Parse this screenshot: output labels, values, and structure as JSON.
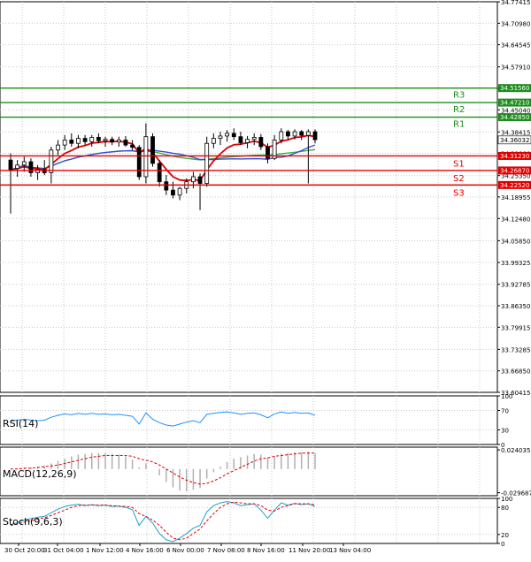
{
  "chart_data": [
    {
      "type": "candlestick",
      "panel": "price",
      "yticks": [
        34.77415,
        34.7098,
        34.64545,
        34.5791,
        34.51475,
        34.4504,
        34.38415,
        34.3198,
        34.2535,
        34.18955,
        34.1248,
        34.0585,
        33.99325,
        33.92785,
        33.8635,
        33.79915,
        33.73285,
        33.6685,
        33.60415
      ],
      "ytick_labels": [
        "34.77415",
        "34.70980",
        "34.64545",
        "34.57910",
        "34.51475",
        "34.45040",
        "34.38415",
        "34.31980",
        "34.25350",
        "34.18955",
        "34.12480",
        "34.05850",
        "33.99325",
        "33.92785",
        "33.86350",
        "33.79915",
        "33.73285",
        "33.66850",
        "33.60415"
      ],
      "ylim": [
        33.60415,
        34.77415
      ],
      "current_price": 34.36032,
      "current_price_label": "34.36032",
      "levels": [
        {
          "name": "R3",
          "value": 34.5156,
          "label": "34.51560",
          "color": "#1e8c1e"
        },
        {
          "name": "R2",
          "value": 34.4721,
          "label": "34.47210",
          "color": "#1e8c1e"
        },
        {
          "name": "R1",
          "value": 34.4285,
          "label": "34.42850",
          "color": "#1e8c1e"
        },
        {
          "name": "S1",
          "value": 34.3123,
          "label": "34.31230",
          "color": "#e00000"
        },
        {
          "name": "S2",
          "value": 34.2687,
          "label": "34.26870",
          "color": "#e00000"
        },
        {
          "name": "S3",
          "value": 34.2252,
          "label": "34.22520",
          "color": "#e00000"
        }
      ],
      "x_labels": [
        "30 Oct 20:00",
        "31 Oct 04:00",
        "1 Nov 12:00",
        "4 Nov 16:00",
        "6 Nov 00:00",
        "7 Nov 08:00",
        "8 Nov 16:00",
        "11 Nov 20:00",
        "13 Nov 04:00"
      ],
      "candles": [
        [
          34.3,
          34.32,
          34.14,
          34.27
        ],
        [
          34.275,
          34.3,
          34.25,
          34.285
        ],
        [
          34.285,
          34.31,
          34.265,
          34.295
        ],
        [
          34.295,
          34.305,
          34.25,
          34.262
        ],
        [
          34.262,
          34.285,
          34.24,
          34.272
        ],
        [
          34.272,
          34.3,
          34.255,
          34.262
        ],
        [
          34.262,
          34.34,
          34.23,
          34.33
        ],
        [
          34.33,
          34.36,
          34.315,
          34.345
        ],
        [
          34.345,
          34.375,
          34.33,
          34.36
        ],
        [
          34.36,
          34.38,
          34.34,
          34.35
        ],
        [
          34.35,
          34.375,
          34.335,
          34.365
        ],
        [
          34.365,
          34.375,
          34.345,
          34.355
        ],
        [
          34.355,
          34.375,
          34.34,
          34.368
        ],
        [
          34.368,
          34.38,
          34.35,
          34.358
        ],
        [
          34.358,
          34.37,
          34.34,
          34.362
        ],
        [
          34.362,
          34.37,
          34.345,
          34.354
        ],
        [
          34.354,
          34.37,
          34.34,
          34.36
        ],
        [
          34.36,
          34.372,
          34.34,
          34.345
        ],
        [
          34.345,
          34.36,
          34.33,
          34.338
        ],
        [
          34.338,
          34.345,
          34.24,
          34.25
        ],
        [
          34.25,
          34.41,
          34.23,
          34.37
        ],
        [
          34.37,
          34.38,
          34.28,
          34.29
        ],
        [
          34.29,
          34.3,
          34.22,
          34.235
        ],
        [
          34.235,
          34.255,
          34.195,
          34.21
        ],
        [
          34.21,
          34.235,
          34.185,
          34.195
        ],
        [
          34.195,
          34.22,
          34.18,
          34.215
        ],
        [
          34.215,
          34.245,
          34.2,
          34.235
        ],
        [
          34.235,
          34.265,
          34.215,
          34.25
        ],
        [
          34.25,
          34.26,
          34.15,
          34.23
        ],
        [
          34.23,
          34.37,
          34.22,
          34.35
        ],
        [
          34.35,
          34.38,
          34.335,
          34.365
        ],
        [
          34.365,
          34.385,
          34.345,
          34.372
        ],
        [
          34.372,
          34.39,
          34.355,
          34.38
        ],
        [
          34.38,
          34.395,
          34.36,
          34.37
        ],
        [
          34.37,
          34.385,
          34.345,
          34.352
        ],
        [
          34.352,
          34.372,
          34.335,
          34.362
        ],
        [
          34.362,
          34.38,
          34.345,
          34.368
        ],
        [
          34.368,
          34.378,
          34.33,
          34.34
        ],
        [
          34.34,
          34.35,
          34.29,
          34.305
        ],
        [
          34.305,
          34.375,
          34.3,
          34.36
        ],
        [
          34.36,
          34.395,
          34.35,
          34.385
        ],
        [
          34.385,
          34.39,
          34.36,
          34.372
        ],
        [
          34.372,
          34.392,
          34.362,
          34.385
        ],
        [
          34.385,
          34.39,
          34.36,
          34.374
        ],
        [
          34.374,
          34.392,
          34.23,
          34.385
        ],
        [
          34.385,
          34.392,
          34.35,
          34.361
        ]
      ]
    },
    {
      "type": "line",
      "panel": "rsi",
      "title": "RSI(14)",
      "yticks": [
        100,
        70,
        30,
        0
      ],
      "ytick_labels": [
        "100",
        "70",
        "30",
        "0"
      ],
      "ylim": [
        0,
        100
      ],
      "values": [
        48,
        50,
        52,
        50,
        49,
        50,
        56,
        60,
        63,
        61,
        64,
        62,
        64,
        62,
        63,
        61,
        62,
        60,
        58,
        42,
        65,
        52,
        45,
        40,
        38,
        42,
        46,
        49,
        45,
        62,
        64,
        66,
        67,
        65,
        62,
        64,
        65,
        61,
        55,
        63,
        67,
        64,
        66,
        64,
        65,
        60
      ]
    },
    {
      "type": "bar",
      "panel": "macd",
      "title": "MACD(12,26,9)",
      "yticks": [
        0.024035,
        -0.029687
      ],
      "ytick_labels": [
        "0.024035",
        "-0.029687"
      ],
      "ylim": [
        -0.0335,
        0.0275
      ],
      "histogram": [
        0.0,
        0.001,
        0.002,
        0.002,
        0.003,
        0.004,
        0.007,
        0.01,
        0.013,
        0.016,
        0.018,
        0.019,
        0.02,
        0.02,
        0.02,
        0.019,
        0.018,
        0.016,
        0.012,
        0.002,
        0.007,
        0.0,
        -0.008,
        -0.016,
        -0.023,
        -0.027,
        -0.028,
        -0.026,
        -0.024,
        -0.012,
        -0.004,
        0.003,
        0.009,
        0.013,
        0.015,
        0.017,
        0.019,
        0.018,
        0.014,
        0.016,
        0.019,
        0.02,
        0.021,
        0.021,
        0.022,
        0.02
      ],
      "signal": [
        0.0,
        0.0,
        0.001,
        0.001,
        0.002,
        0.003,
        0.004,
        0.005,
        0.007,
        0.009,
        0.011,
        0.013,
        0.015,
        0.016,
        0.017,
        0.017,
        0.017,
        0.017,
        0.016,
        0.013,
        0.011,
        0.009,
        0.005,
        0.0,
        -0.005,
        -0.01,
        -0.014,
        -0.017,
        -0.019,
        -0.018,
        -0.015,
        -0.011,
        -0.006,
        -0.002,
        0.002,
        0.006,
        0.01,
        0.013,
        0.014,
        0.016,
        0.017,
        0.018,
        0.019,
        0.02,
        0.02,
        0.02
      ]
    },
    {
      "type": "line",
      "panel": "stoch",
      "title": "Stoch(9,6,3)",
      "yticks": [
        100,
        80,
        20,
        0
      ],
      "ytick_labels": [
        "100",
        "80",
        "20",
        "0"
      ],
      "ylim": [
        0,
        100
      ],
      "main": [
        42,
        46,
        52,
        55,
        58,
        60,
        68,
        76,
        82,
        85,
        87,
        84,
        86,
        84,
        85,
        82,
        83,
        80,
        75,
        40,
        60,
        45,
        22,
        8,
        4,
        12,
        22,
        34,
        40,
        70,
        84,
        90,
        93,
        90,
        84,
        86,
        88,
        74,
        56,
        74,
        90,
        85,
        89,
        86,
        88,
        82
      ],
      "signal": [
        40,
        43,
        47,
        50,
        54,
        57,
        62,
        68,
        74,
        80,
        84,
        85,
        85,
        85,
        85,
        84,
        83,
        82,
        80,
        66,
        60,
        52,
        40,
        25,
        12,
        8,
        12,
        22,
        32,
        50,
        66,
        80,
        88,
        92,
        90,
        88,
        88,
        84,
        74,
        72,
        80,
        84,
        88,
        88,
        88,
        86
      ]
    }
  ]
}
